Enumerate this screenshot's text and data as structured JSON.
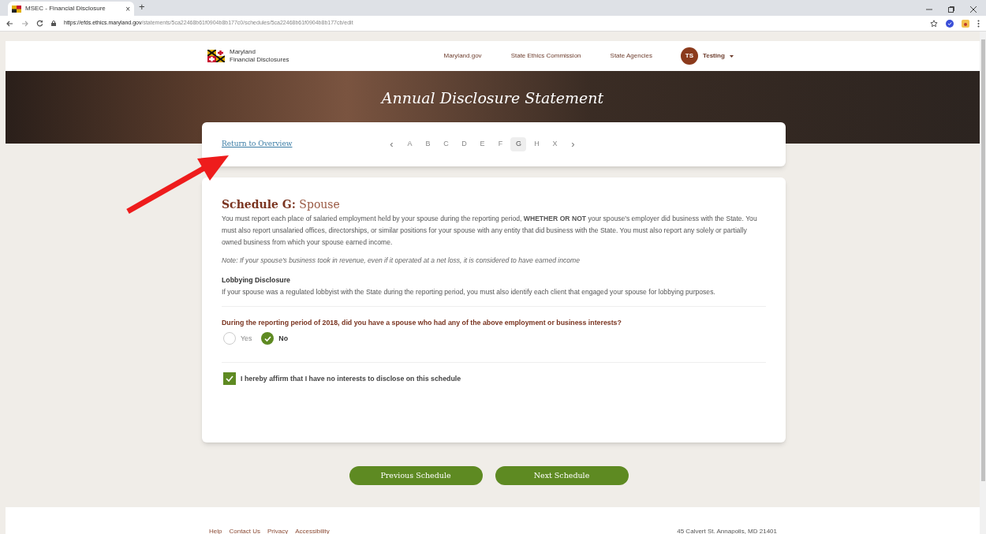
{
  "browser": {
    "tab_title": "MSEC - Financial Disclosure",
    "tab_close": "×",
    "new_tab": "+",
    "url": {
      "host": "https://efds.ethics.maryland.gov",
      "path": "/statements/5ca22468b61f0904b8b177c0/schedules/5ca22468b61f0904b8b177cb/edit"
    }
  },
  "header": {
    "logo_line1": "Maryland",
    "logo_line2": "Financial Disclosures",
    "nav": [
      "Maryland.gov",
      "State Ethics Commission",
      "State Agencies"
    ],
    "user": {
      "initials": "TS",
      "name": "Testing"
    }
  },
  "banner": {
    "title": "Annual Disclosure Statement"
  },
  "schedule_nav": {
    "return_link": "Return to Overview",
    "prev": "‹",
    "next": "›",
    "letters": [
      {
        "label": "A",
        "selected": false
      },
      {
        "label": "B",
        "selected": false
      },
      {
        "label": "C",
        "selected": false
      },
      {
        "label": "D",
        "selected": false
      },
      {
        "label": "E",
        "selected": false
      },
      {
        "label": "F",
        "selected": false
      },
      {
        "label": "G",
        "selected": true
      },
      {
        "label": "H",
        "selected": false
      },
      {
        "label": "X",
        "selected": false
      }
    ]
  },
  "schedule": {
    "title_prefix": "Schedule G:",
    "title_name": "Spouse",
    "intro": "You must report each place of salaried employment held by your spouse during the reporting period, **WHETHER OR NOT** your spouse's employer did business with the State. You must also report unsalaried offices, directorships, or similar positions for your spouse with any entity that did business with the State. You must also report any solely or partially owned business from which your spouse earned income.",
    "note": "Note: If your spouse's business took in revenue, even if it operated at a net loss, it is considered to have earned income",
    "lobbying_heading": "Lobbying Disclosure",
    "lobbying_text": "If your spouse was a regulated lobbyist with the State during the reporting period, you must also identify each client that engaged your spouse for lobbying purposes.",
    "question": "During the reporting period of 2018, did you have a spouse who had any of the above employment or business interests?",
    "options": [
      {
        "label": "Yes",
        "selected": false
      },
      {
        "label": "No",
        "selected": true
      }
    ],
    "affirm": {
      "label": "I hereby affirm that I have no interests to disclose on this schedule",
      "checked": true
    }
  },
  "buttons": [
    "Previous Schedule",
    "Next Schedule"
  ],
  "footer": {
    "links": [
      "Help",
      "Contact Us",
      "Privacy",
      "Accessibility"
    ],
    "address": "45 Calvert St. Annapolis, MD 21401"
  }
}
